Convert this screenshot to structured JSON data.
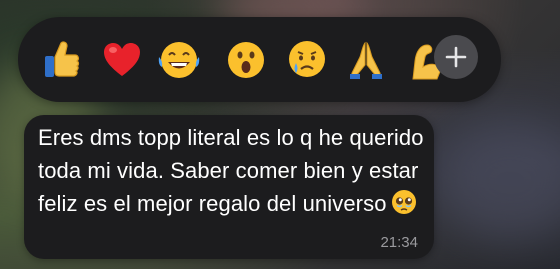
{
  "reactions": [
    {
      "name": "thumbs-up",
      "glyph": "👍"
    },
    {
      "name": "red-heart",
      "glyph": "❤️"
    },
    {
      "name": "face-with-tears-of-joy",
      "glyph": "😂"
    },
    {
      "name": "face-with-open-mouth",
      "glyph": "😮"
    },
    {
      "name": "crying-face",
      "glyph": "😢"
    },
    {
      "name": "folded-hands",
      "glyph": "🙏"
    },
    {
      "name": "flexed-biceps",
      "glyph": "💪"
    }
  ],
  "more_reactions_icon": "plus-icon",
  "message": {
    "text": "Eres dms topp literal es lo q he querido toda mi vida. Saber comer bien y estar feliz es el mejor regalo del universo",
    "emoji": "🥹",
    "timestamp": "21:34"
  },
  "colors": {
    "bubble_bg": "#1c1c1e",
    "bar_bg": "#1c1c1e",
    "plus_bg": "#4a4a4e",
    "text": "#ffffff",
    "timestamp": "#9a9a9e"
  }
}
